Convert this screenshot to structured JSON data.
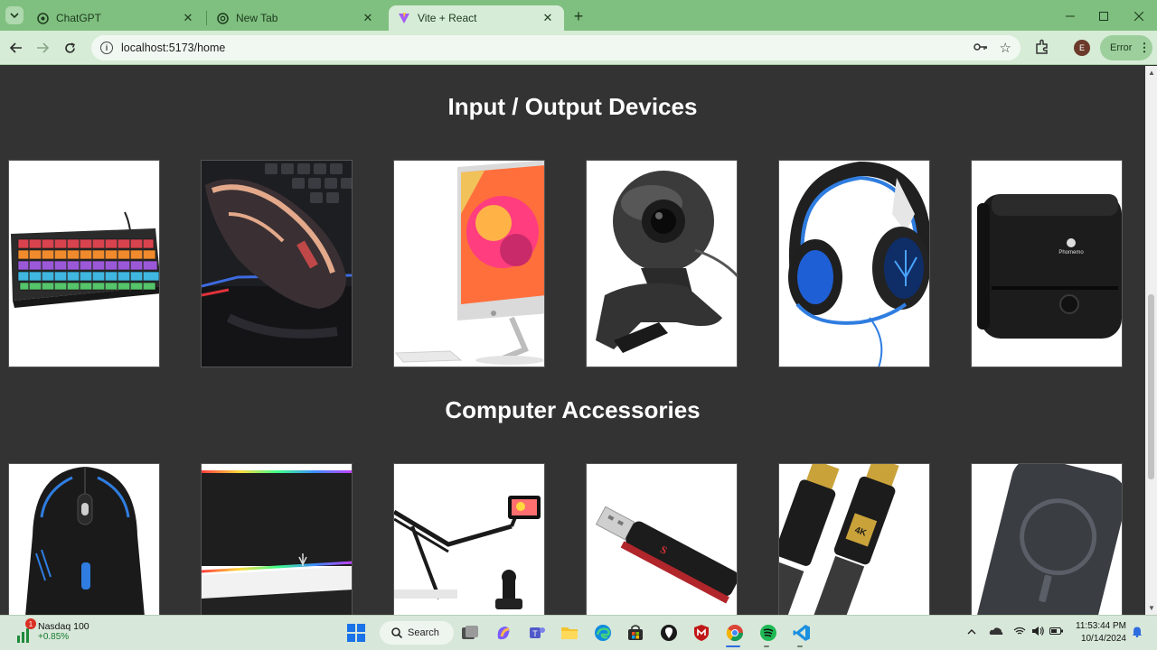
{
  "browser": {
    "tabs": [
      {
        "title": "ChatGPT",
        "icon": "chatgpt-icon",
        "active": false
      },
      {
        "title": "New Tab",
        "icon": "chrome-icon",
        "active": false
      },
      {
        "title": "Vite + React",
        "icon": "vite-icon",
        "active": true
      }
    ],
    "url": "localhost:5173/home",
    "profile_initial": "E",
    "error_label": "Error"
  },
  "page": {
    "sections": [
      {
        "title": "Input / Output Devices",
        "products": [
          {
            "icon": "keyboard-image"
          },
          {
            "icon": "gaming-mouse-image"
          },
          {
            "icon": "imac-monitor-image"
          },
          {
            "icon": "webcam-image"
          },
          {
            "icon": "headset-image"
          },
          {
            "icon": "mini-printer-image",
            "brand": "Phomemo"
          }
        ]
      },
      {
        "title": "Computer Accessories",
        "products": [
          {
            "icon": "wireless-mouse-image"
          },
          {
            "icon": "rgb-mousepad-image"
          },
          {
            "icon": "phone-arm-stand-image"
          },
          {
            "icon": "usb-flash-drive-image"
          },
          {
            "icon": "hdmi-cable-image",
            "print": "4K"
          },
          {
            "icon": "power-bank-image"
          }
        ]
      }
    ]
  },
  "taskbar": {
    "widget": {
      "name": "Nasdaq 100",
      "change": "+0.85%",
      "badge": "1"
    },
    "search_label": "Search",
    "time": "11:53:44 PM",
    "date": "10/14/2024"
  },
  "colors": {
    "chrome_green": "#7fbf7f",
    "toolbar_green": "#d6ecd6",
    "page_bg": "#333333",
    "taskbar_bg": "#d7e7d9"
  }
}
